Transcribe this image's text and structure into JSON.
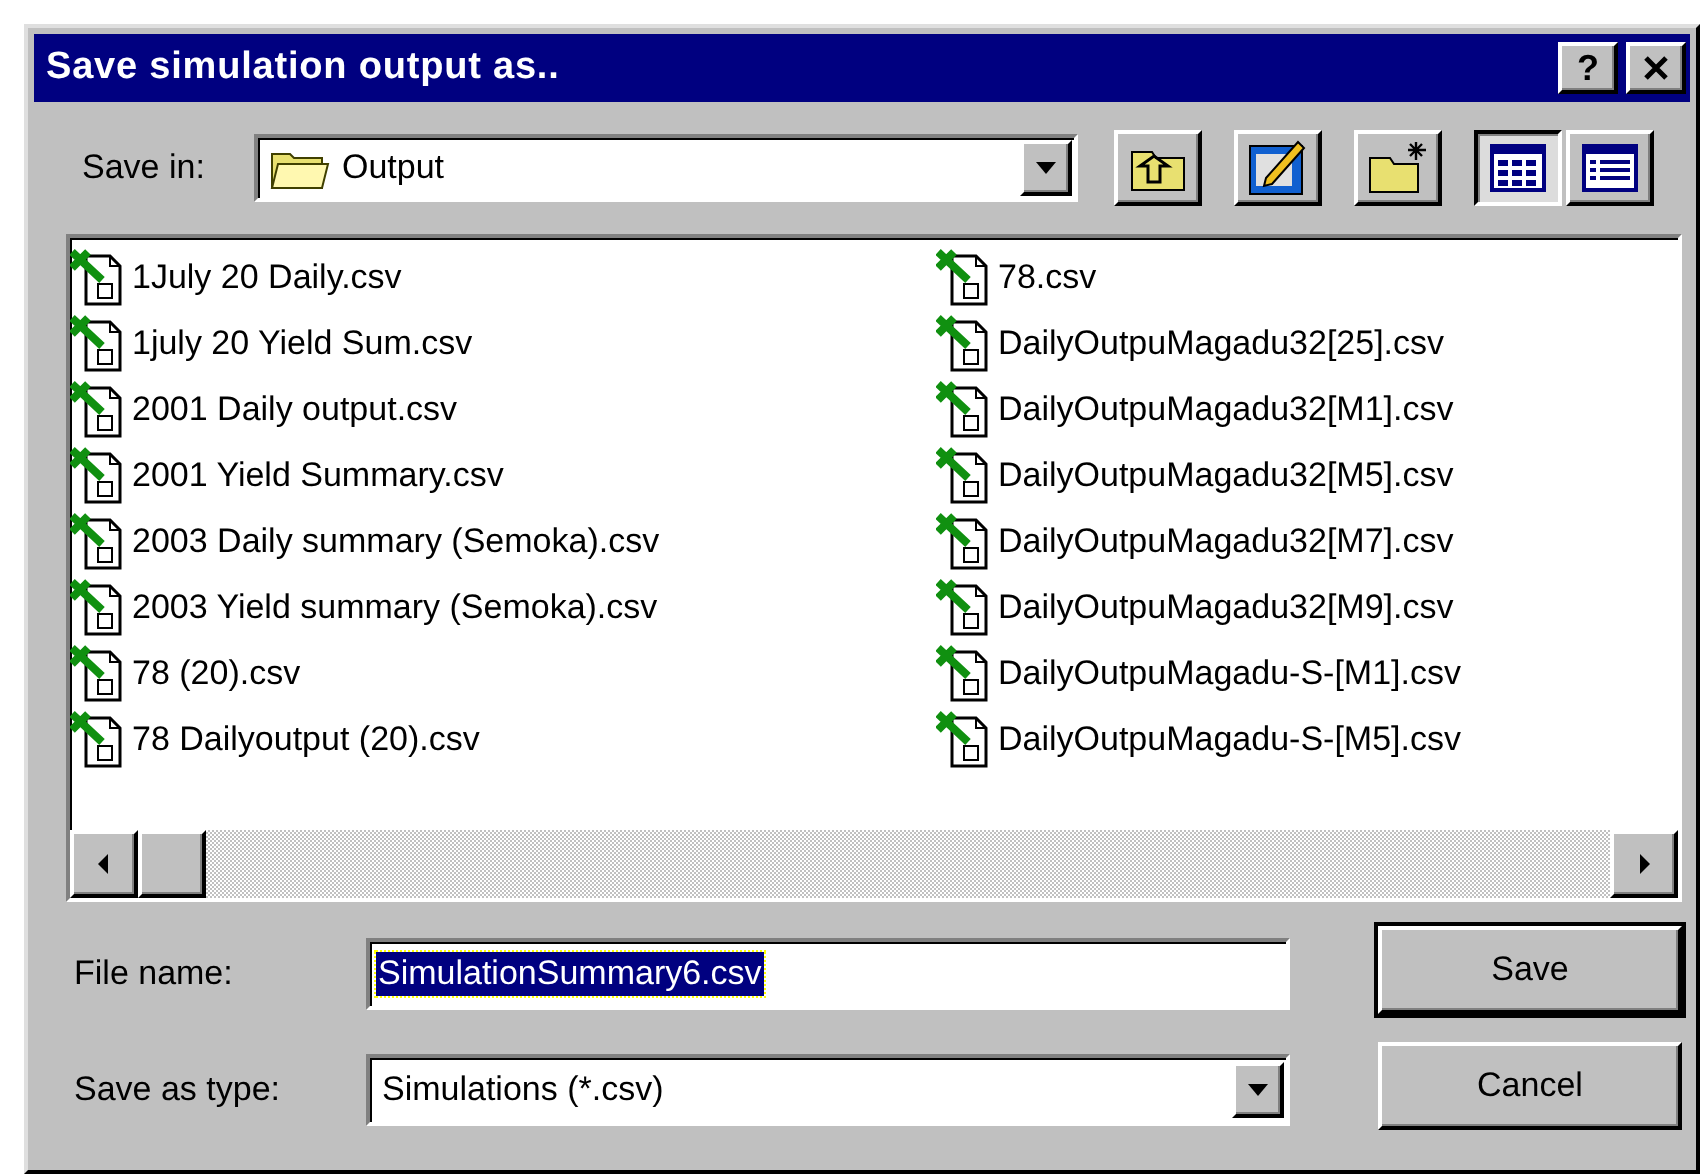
{
  "window": {
    "title": "Save simulation output as..",
    "title_buttons": [
      {
        "kind": "help",
        "label": "?"
      },
      {
        "kind": "close"
      }
    ]
  },
  "save_in": {
    "label": "Save in:",
    "value": "Output"
  },
  "toolbar": [
    {
      "kind": "up-folder",
      "selected": false
    },
    {
      "kind": "tools",
      "selected": false
    },
    {
      "kind": "new-folder",
      "selected": false
    },
    {
      "kind": "list-view",
      "selected": true
    },
    {
      "kind": "details-view",
      "selected": false
    }
  ],
  "files": [
    {
      "name": "1July 20 Daily.csv"
    },
    {
      "name": "1july 20 Yield Sum.csv"
    },
    {
      "name": "2001 Daily output.csv"
    },
    {
      "name": "2001 Yield Summary.csv"
    },
    {
      "name": "2003 Daily summary (Semoka).csv"
    },
    {
      "name": "2003 Yield summary (Semoka).csv"
    },
    {
      "name": "78 (20).csv"
    },
    {
      "name": "78 Dailyoutput (20).csv"
    },
    {
      "name": "78.csv"
    },
    {
      "name": "DailyOutpuMagadu32[25].csv"
    },
    {
      "name": "DailyOutpuMagadu32[M1].csv"
    },
    {
      "name": "DailyOutpuMagadu32[M5].csv"
    },
    {
      "name": "DailyOutpuMagadu32[M7].csv"
    },
    {
      "name": "DailyOutpuMagadu32[M9].csv"
    },
    {
      "name": "DailyOutpuMagadu-S-[M1].csv"
    },
    {
      "name": "DailyOutpuMagadu-S-[M5].csv"
    }
  ],
  "file_name": {
    "label": "File name:",
    "value": "SimulationSummary6.csv",
    "text_selected": true
  },
  "save_as_type": {
    "label": "Save as type:",
    "value": "Simulations (*.csv)"
  },
  "buttons": [
    {
      "label": "Save",
      "default": true
    },
    {
      "label": "Cancel",
      "default": false
    }
  ]
}
